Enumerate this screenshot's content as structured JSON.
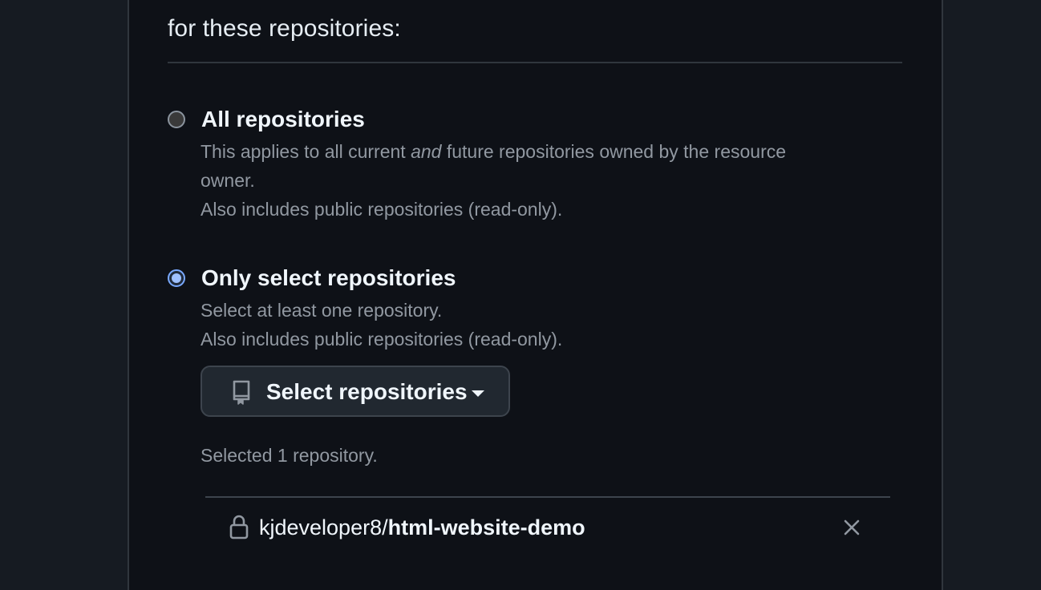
{
  "section": {
    "heading": "for these repositories:"
  },
  "options": [
    {
      "title": "All repositories",
      "checked": false,
      "desc_part1": "This applies to all current ",
      "desc_em": "and",
      "desc_part2": " future repositories owned by the resource",
      "desc_line2": "owner.",
      "desc_line3": "Also includes public repositories (read-only)."
    },
    {
      "title": "Only select repositories",
      "checked": true,
      "desc_line1": "Select at least one repository.",
      "desc_line2": "Also includes public repositories (read-only)."
    }
  ],
  "select_button": {
    "label": "Select repositories",
    "icon": "repo-icon"
  },
  "selection": {
    "count_text": "Selected 1 repository."
  },
  "repositories": [
    {
      "owner": "kjdeveloper8/",
      "name": "html-website-demo",
      "icon": "lock-icon"
    }
  ],
  "colors": {
    "page_bg": "#161b22",
    "panel_bg": "#0e1117",
    "text": "#f0f6fc",
    "muted": "#9198a1",
    "accent": "#79a9ff"
  }
}
